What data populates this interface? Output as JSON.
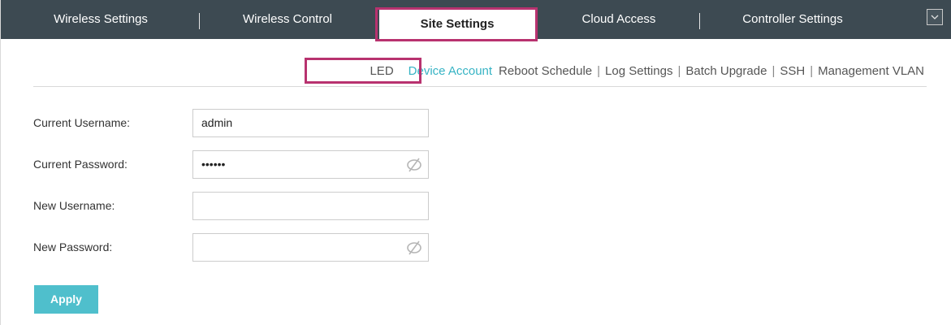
{
  "nav": {
    "tabs": [
      {
        "label": "Wireless Settings"
      },
      {
        "label": "Wireless Control"
      },
      {
        "label": "Site Settings",
        "active": true
      },
      {
        "label": "Cloud Access"
      },
      {
        "label": "Controller Settings"
      }
    ],
    "dropdown_icon": "chevron-down-icon"
  },
  "subnav": {
    "items": [
      {
        "label": "LED"
      },
      {
        "label": "Device Account",
        "active": true
      },
      {
        "label": "Reboot Schedule"
      },
      {
        "label": "Log Settings"
      },
      {
        "label": "Batch Upgrade"
      },
      {
        "label": "SSH"
      },
      {
        "label": "Management VLAN"
      }
    ]
  },
  "form": {
    "current_username": {
      "label": "Current Username:",
      "value": "admin"
    },
    "current_password": {
      "label": "Current Password:",
      "value": "••••••",
      "icon": "eye-hidden-icon"
    },
    "new_username": {
      "label": "New Username:",
      "value": ""
    },
    "new_password": {
      "label": "New Password:",
      "value": "",
      "icon": "eye-hidden-icon"
    },
    "apply_label": "Apply"
  },
  "colors": {
    "nav_bg": "#3d4a52",
    "accent": "#36b3c4",
    "apply_bg": "#4fbfcc",
    "highlight": "#b8326f"
  }
}
